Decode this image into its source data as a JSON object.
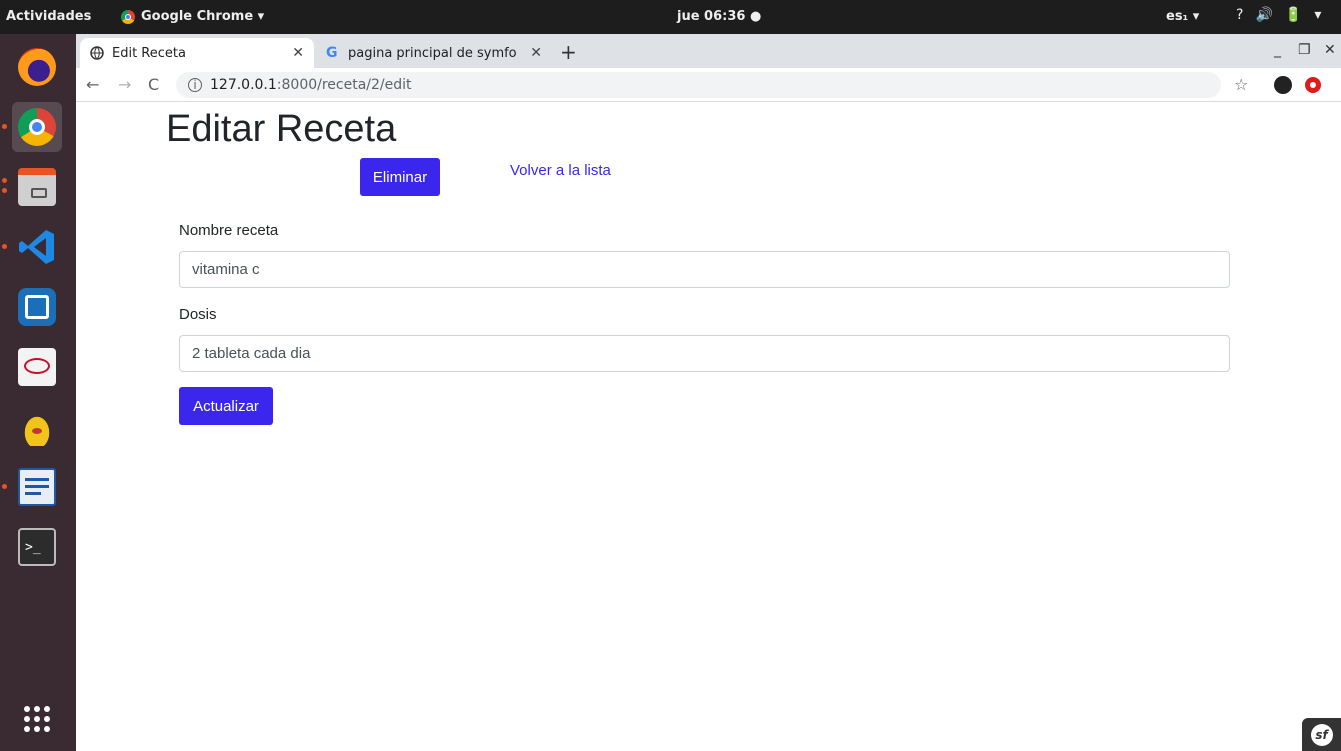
{
  "topbar": {
    "activities": "Actividades",
    "app_name": "Google Chrome ▾",
    "clock": "jue 06:36 ●",
    "lang": "es₁ ▾",
    "sys_icons": [
      "?",
      "🔊",
      "🔋",
      "▾"
    ]
  },
  "dock": {
    "items": [
      {
        "icon": "firefox-icon"
      },
      {
        "icon": "chrome-icon"
      },
      {
        "icon": "files-icon"
      },
      {
        "icon": "vscode-icon"
      },
      {
        "icon": "boxes-icon"
      },
      {
        "icon": "acrobat-icon"
      },
      {
        "icon": "genie-icon"
      },
      {
        "icon": "writer-icon"
      },
      {
        "icon": "terminal-icon"
      },
      {
        "icon": "show-apps-icon"
      }
    ]
  },
  "tabs": [
    {
      "title": "Edit Receta"
    },
    {
      "title": "pagina principal de symfo"
    }
  ],
  "address": {
    "host": "127.0.0.1",
    "path": ":8000/receta/2/edit"
  },
  "page": {
    "title": "Editar Receta",
    "delete_label": "Eliminar",
    "back_link": "Volver a la lista",
    "fields": [
      {
        "label": "Nombre receta",
        "value": "vitamina c"
      },
      {
        "label": "Dosis",
        "value": "2 tableta cada dia"
      }
    ],
    "submit_label": "Actualizar"
  },
  "colors": {
    "primary": "#3a26ed",
    "dock_bg": "#3a2b33",
    "topbar_bg": "#1d1d1d"
  }
}
